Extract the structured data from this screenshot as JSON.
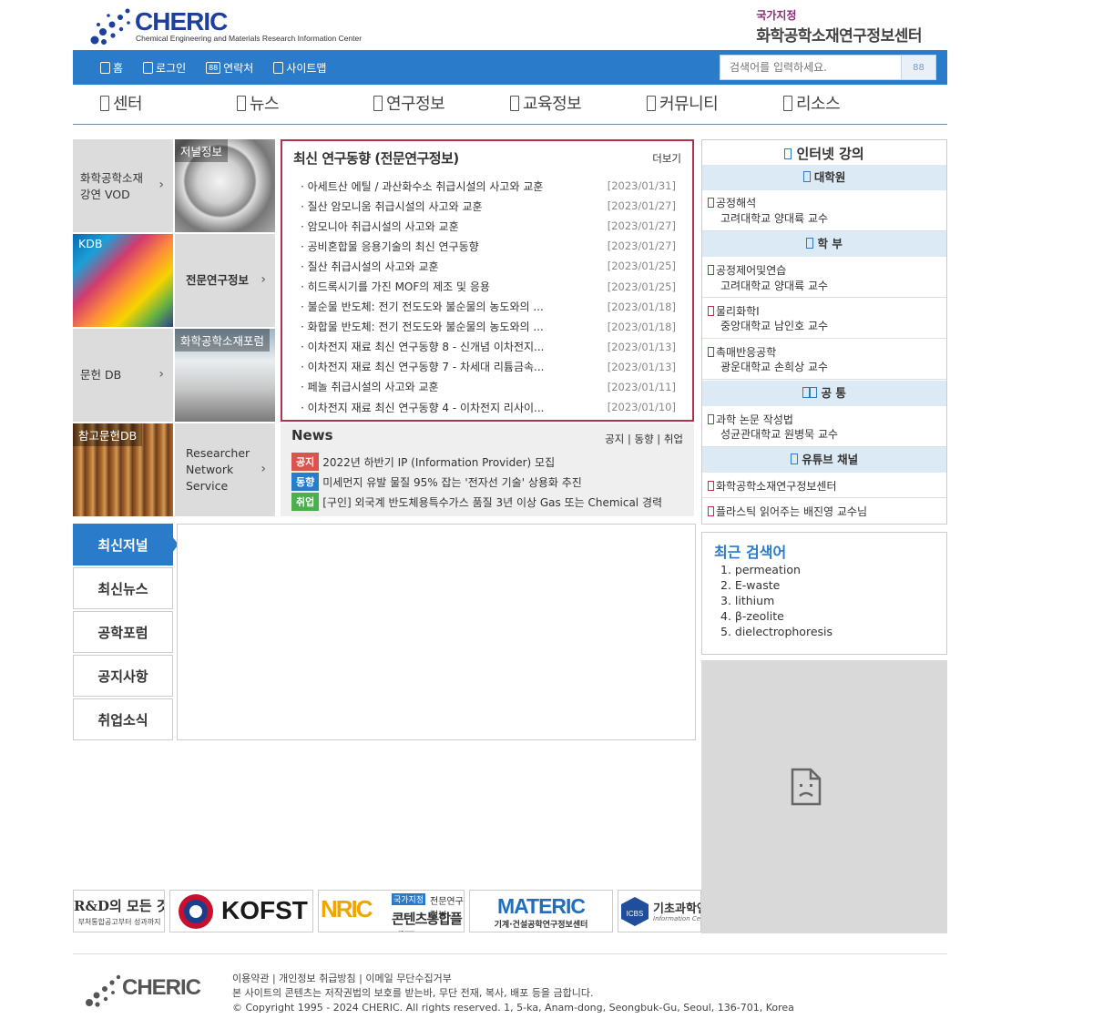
{
  "header": {
    "logo_text": "CHERIC",
    "logo_subtitle": "Chemical Engineering and Materials Research Information Center",
    "national_tag": "국가지정",
    "national_center": "화학공학소재연구정보센터"
  },
  "topbar": {
    "links": [
      {
        "label": "홈",
        "icon": "home-icon"
      },
      {
        "label": "로그인",
        "icon": "login-icon"
      },
      {
        "label": "연락처",
        "icon": "contact-icon"
      },
      {
        "label": "사이트맵",
        "icon": "sitemap-icon"
      }
    ],
    "search_placeholder": "검색어를 입력하세요.",
    "search_button_glyph": "88"
  },
  "mainnav": [
    "센터",
    "뉴스",
    "연구정보",
    "교육정보",
    "커뮤니티",
    "리소스"
  ],
  "tiles": {
    "vod": "화학공학소재\n강연 VOD",
    "journal": "저널정보",
    "kdb": "KDB",
    "expert": "전문연구정보",
    "docdb": "문헌 DB",
    "forum": "화학공학소재포럼",
    "refdb": "참고문헌DB",
    "researcher": "Researcher\nNetwork\nService"
  },
  "research": {
    "title": "최신 연구동향 (전문연구정보)",
    "more": "더보기",
    "items": [
      {
        "title": "· 아세트산 에틸 / 과산화수소 취급시설의 사고와 교훈",
        "date": "[2023/01/31]"
      },
      {
        "title": "· 질산 암모니움 취급시설의 사고와 교훈",
        "date": "[2023/01/27]"
      },
      {
        "title": "· 암모니아 취급시설의 사고와 교훈",
        "date": "[2023/01/27]"
      },
      {
        "title": "· 공비혼합물 응용기술의 최신 연구동향",
        "date": "[2023/01/27]"
      },
      {
        "title": "· 질산 취급시설의 사고와 교훈",
        "date": "[2023/01/25]"
      },
      {
        "title": "· 히드록시기를 가진 MOF의 제조 및 응용",
        "date": "[2023/01/25]"
      },
      {
        "title": "· 불순물 반도체: 전기 전도도와 불순물의 농도와의 ...",
        "date": "[2023/01/18]"
      },
      {
        "title": "· 화합물 반도체: 전기 전도도와 불순물의 농도와의 ...",
        "date": "[2023/01/18]"
      },
      {
        "title": "· 이차전지 재료 최신 연구동향 8 - 신개념 이차전지...",
        "date": "[2023/01/13]"
      },
      {
        "title": "· 이차전지 재료 최신 연구동향 7 - 차세대 리튬금속...",
        "date": "[2023/01/13]"
      },
      {
        "title": "· 페놀 취급시설의 사고와 교훈",
        "date": "[2023/01/11]"
      },
      {
        "title": "· 이차전지 재료 최신 연구동향 4 - 이차전지 리사이...",
        "date": "[2023/01/10]"
      }
    ]
  },
  "news": {
    "title": "News",
    "tabs": "공지 | 동향 | 취업",
    "items": [
      {
        "badge": "공지",
        "color": "#d9534f",
        "text": "2022년 하반기 IP (Information Provider) 모집"
      },
      {
        "badge": "동향",
        "color": "#2a7bc9",
        "text": "미세먼지 유발 물질 95% 잡는 '전자선 기술' 상용화 추진"
      },
      {
        "badge": "취업",
        "color": "#4cae4c",
        "text": "[구인] 외국계 반도체용특수가스 품질 3년 이상 Gas 또는 Chemical 경력"
      }
    ]
  },
  "left_tabs": [
    "최신저널",
    "최신뉴스",
    "공학포럼",
    "공지사항",
    "취업소식"
  ],
  "lectures": {
    "title": "인터넷 강의",
    "cat_grad": "대학원",
    "grad": [
      {
        "course": "공정해석",
        "prof": "고려대학교 양대륙 교수"
      }
    ],
    "cat_under": "학 부",
    "under": [
      {
        "course": "공정제어및연습",
        "prof": "고려대학교 양대륙 교수"
      },
      {
        "course": "물리화학I",
        "prof": "중앙대학교 남인호 교수"
      },
      {
        "course": "촉매반응공학",
        "prof": "광운대학교 손희상 교수"
      }
    ],
    "cat_common": "공 통",
    "common": [
      {
        "course": "과학 논문 작성법",
        "prof": "성균관대학교 원병묵 교수"
      }
    ],
    "cat_youtube": "유튜브 채널",
    "youtube": [
      "화학공학소재연구정보센터",
      "플라스틱 읽어주는 배진영 교수님"
    ]
  },
  "recent": {
    "title": "최근 검색어",
    "items": [
      "1.  permeation",
      "2.  E-waste",
      "3.  lithium",
      "4.  β-zeolite",
      "5.  dielectrophoresis"
    ]
  },
  "banners": {
    "b1_line1": "R&D의 모든 것!",
    "b1_line2": "부처통합공고부터 성과까지",
    "kofst": "KOFST",
    "nric_tag": "국가지정",
    "nric_title1": "전문연구정보",
    "nric_title2": "콘텐츠통합플랫폼",
    "materic": "MATERIC",
    "materic_sub": "기계·건설공학연구정보센터",
    "icbs": "기초과학연",
    "icbs_sub": "Information Cente"
  },
  "footer": {
    "logo_text": "CHERIC",
    "links": "이용약관 | 개인정보 취급방침 | 이메일 무단수집거부",
    "notice": "본 사이트의 콘텐츠는 저작권법의 보호를 받는바, 무단 전재, 복사, 배포 등을 금합니다.",
    "copyright": "© Copyright 1995 - 2024 CHERIC. All rights reserved. 1, 5-ka, Anam-dong, Seongbuk-Gu, Seoul, 136-701, Korea"
  }
}
